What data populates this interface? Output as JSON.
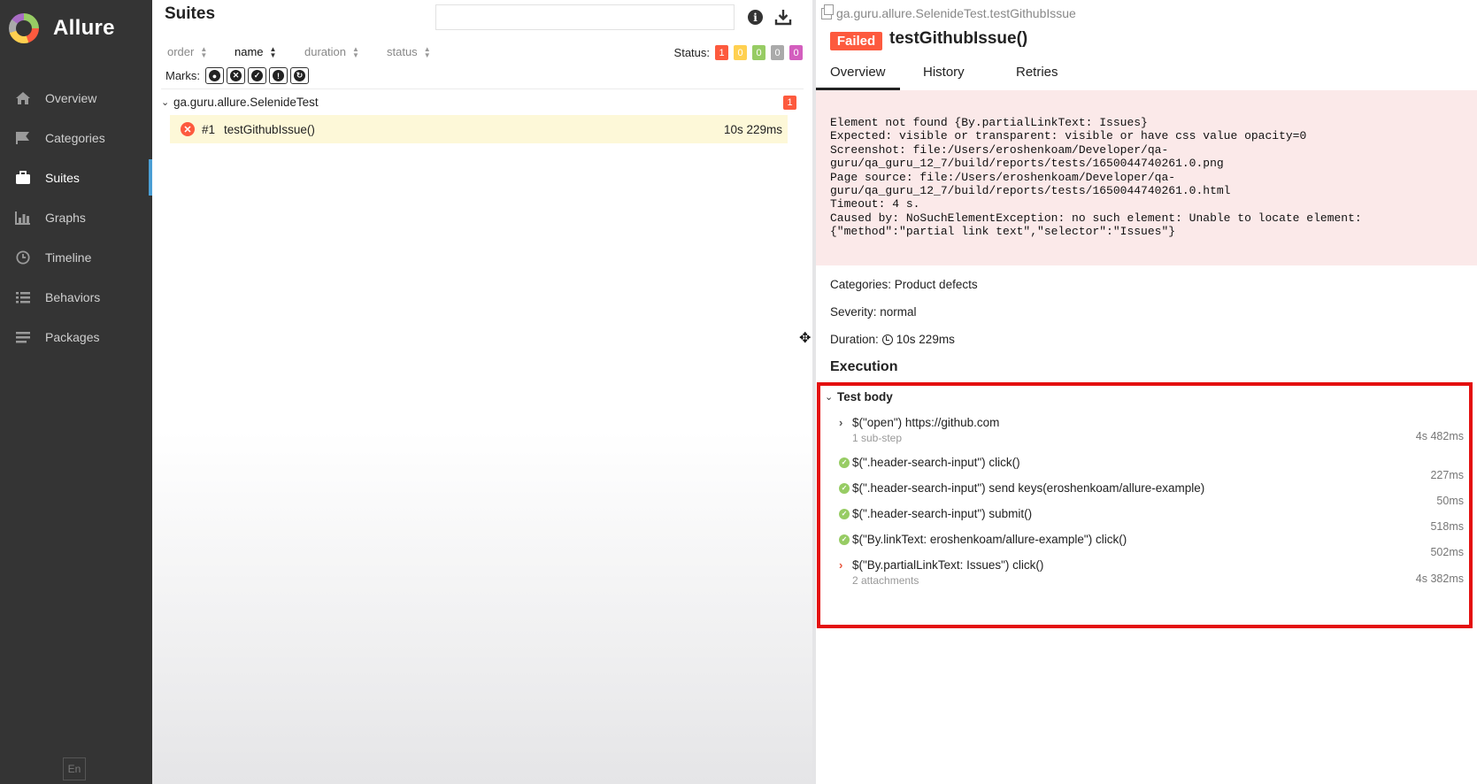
{
  "sidebar": {
    "brand": "Allure",
    "items": [
      {
        "label": "Overview",
        "icon": "home-icon"
      },
      {
        "label": "Categories",
        "icon": "flag-icon"
      },
      {
        "label": "Suites",
        "icon": "briefcase-icon"
      },
      {
        "label": "Graphs",
        "icon": "bar-chart-icon"
      },
      {
        "label": "Timeline",
        "icon": "clock-icon"
      },
      {
        "label": "Behaviors",
        "icon": "list-icon"
      },
      {
        "label": "Packages",
        "icon": "lines-icon"
      }
    ],
    "active_item": "Suites",
    "language": "En"
  },
  "middle": {
    "title": "Suites",
    "search_value": "",
    "sort": {
      "order": "order",
      "name": "name",
      "duration": "duration",
      "status": "status"
    },
    "status_label": "Status:",
    "status_counts": [
      {
        "value": "1",
        "color": "#fd5a3e"
      },
      {
        "value": "0",
        "color": "#ffd050"
      },
      {
        "value": "0",
        "color": "#97cc64"
      },
      {
        "value": "0",
        "color": "#aaaaaa"
      },
      {
        "value": "0",
        "color": "#d35ebe"
      }
    ],
    "marks_label": "Marks:",
    "group": {
      "name": "ga.guru.allure.SelenideTest",
      "count": "1"
    },
    "test": {
      "num": "#1",
      "name": "testGithubIssue()",
      "duration": "10s 229ms"
    }
  },
  "detail": {
    "path": "ga.guru.allure.SelenideTest.testGithubIssue",
    "status": "Failed",
    "title": "testGithubIssue()",
    "tabs": [
      "Overview",
      "History",
      "Retries"
    ],
    "error": "Element not found {By.partialLinkText: Issues}\nExpected: visible or transparent: visible or have css value opacity=0\nScreenshot: file:/Users/eroshenkoam/Developer/qa-\nguru/qa_guru_12_7/build/reports/tests/1650044740261.0.png\nPage source: file:/Users/eroshenkoam/Developer/qa-\nguru/qa_guru_12_7/build/reports/tests/1650044740261.0.html\nTimeout: 4 s.\nCaused by: NoSuchElementException: no such element: Unable to locate element:\n{\"method\":\"partial link text\",\"selector\":\"Issues\"}",
    "categories": "Categories: Product defects",
    "severity": "Severity: normal",
    "duration_label": "Duration:",
    "duration_value": "10s 229ms",
    "execution_title": "Execution",
    "test_body_label": "Test body",
    "steps": [
      {
        "name": "$(\"open\") https://github.com",
        "sub": "1 sub-step",
        "time": "4s 482ms"
      },
      {
        "name": "$(\".header-search-input\") click()",
        "sub": "",
        "time": "227ms"
      },
      {
        "name": "$(\".header-search-input\") send keys(eroshenkoam/allure-example)",
        "sub": "",
        "time": "50ms"
      },
      {
        "name": "$(\".header-search-input\") submit()",
        "sub": "",
        "time": "518ms"
      },
      {
        "name": "$(\"By.linkText: eroshenkoam/allure-example\") click()",
        "sub": "",
        "time": "502ms"
      },
      {
        "name": "$(\"By.partialLinkText: Issues\") click()",
        "sub": "2 attachments",
        "time": "4s 382ms"
      }
    ],
    "highlight_color": "#e40f0f"
  }
}
